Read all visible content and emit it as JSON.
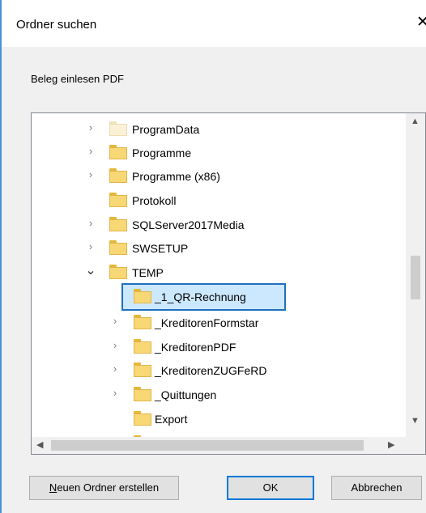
{
  "window": {
    "title": "Ordner suchen",
    "close_glyph": "✕"
  },
  "description": "Beleg einlesen PDF",
  "tree": {
    "items": [
      {
        "label": "ProgramData",
        "expander": "›",
        "icon": "folder-light-icon"
      },
      {
        "label": "Programme",
        "expander": "›",
        "icon": "folder-icon"
      },
      {
        "label": "Programme (x86)",
        "expander": "›",
        "icon": "folder-icon"
      },
      {
        "label": "Protokoll",
        "expander": "",
        "icon": "folder-icon"
      },
      {
        "label": "SQLServer2017Media",
        "expander": "›",
        "icon": "folder-icon"
      },
      {
        "label": "SWSETUP",
        "expander": "›",
        "icon": "folder-icon"
      },
      {
        "label": "TEMP",
        "expander": "⌄",
        "icon": "folder-icon"
      },
      {
        "label": "_1_QR-Rechnung",
        "expander": "",
        "icon": "folder-icon",
        "selected": true
      },
      {
        "label": "_KreditorenFormstar",
        "expander": "›",
        "icon": "folder-icon"
      },
      {
        "label": "_KreditorenPDF",
        "expander": "›",
        "icon": "folder-icon"
      },
      {
        "label": "_KreditorenZUGFeRD",
        "expander": "›",
        "icon": "folder-icon"
      },
      {
        "label": "_Quittungen",
        "expander": "›",
        "icon": "folder-icon"
      },
      {
        "label": "Export",
        "expander": "",
        "icon": "folder-icon"
      }
    ]
  },
  "scrollbars": {
    "up": "▲",
    "down": "▼",
    "left": "◀",
    "right": "▶"
  },
  "buttons": {
    "new_folder": {
      "label_first": "N",
      "label_rest": "euen Ordner erstellen"
    },
    "ok": "OK",
    "cancel": "Abbrechen"
  }
}
